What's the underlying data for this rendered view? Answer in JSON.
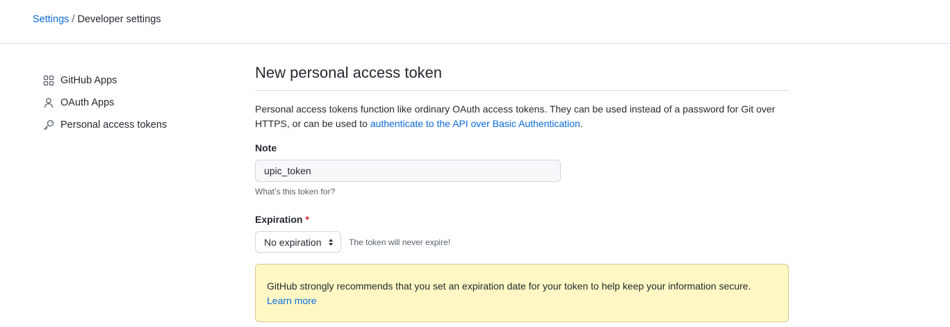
{
  "breadcrumb": {
    "root": "Settings",
    "separator": "/",
    "current": "Developer settings"
  },
  "sidebar": {
    "items": [
      {
        "label": "GitHub Apps",
        "icon": "apps-grid-icon"
      },
      {
        "label": "OAuth Apps",
        "icon": "person-icon"
      },
      {
        "label": "Personal access tokens",
        "icon": "key-icon"
      }
    ]
  },
  "main": {
    "title": "New personal access token",
    "description_before": "Personal access tokens function like ordinary OAuth access tokens. They can be used instead of a password for Git over HTTPS, or can be used to ",
    "description_link": "authenticate to the API over Basic Authentication",
    "description_after": ".",
    "note": {
      "label": "Note",
      "value": "upic_token",
      "hint": "What’s this token for?"
    },
    "expiration": {
      "label": "Expiration",
      "required_marker": "*",
      "selected": "No expiration",
      "note": "The token will never expire!"
    },
    "warning": {
      "text": "GitHub strongly recommends that you set an expiration date for your token to help keep your information secure.",
      "link": "Learn more"
    }
  },
  "colors": {
    "link": "#0969da",
    "warning_bg": "#fff8c5",
    "required": "#cf222e"
  }
}
